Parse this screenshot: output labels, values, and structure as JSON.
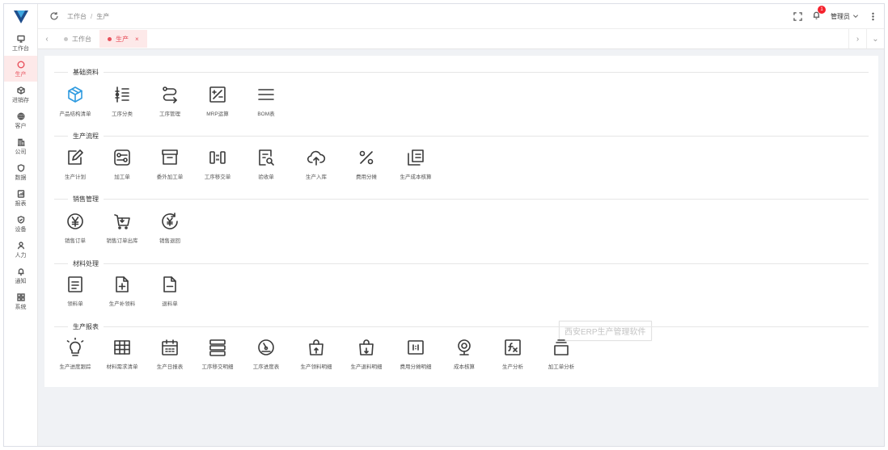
{
  "sidebar": {
    "items": [
      {
        "label": "工作台",
        "icon": "monitor-icon"
      },
      {
        "label": "生产",
        "icon": "circle-icon",
        "active": true
      },
      {
        "label": "进销存",
        "icon": "box-icon"
      },
      {
        "label": "客户",
        "icon": "globe-icon"
      },
      {
        "label": "公司",
        "icon": "building-icon"
      },
      {
        "label": "数据",
        "icon": "shield-icon"
      },
      {
        "label": "报表",
        "icon": "report-icon"
      },
      {
        "label": "设备",
        "icon": "device-icon"
      },
      {
        "label": "人力",
        "icon": "user-icon"
      },
      {
        "label": "通知",
        "icon": "bell-icon"
      },
      {
        "label": "系统",
        "icon": "grid-icon"
      }
    ]
  },
  "header": {
    "breadcrumb": [
      "工作台",
      "生产"
    ],
    "notification_count": "1",
    "user_name": "管理员"
  },
  "tabs": [
    {
      "label": "工作台",
      "active": false
    },
    {
      "label": "生产",
      "active": true,
      "close": "×"
    }
  ],
  "sections": [
    {
      "title": "基础资料",
      "items": [
        "产品结构清单",
        "工序分类",
        "工序管理",
        "MRP运算",
        "BOM表"
      ]
    },
    {
      "title": "生产流程",
      "items": [
        "生产计划",
        "加工单",
        "委外加工单",
        "工序移交单",
        "验收单",
        "生产入库",
        "费用分摊",
        "生产成本核算"
      ]
    },
    {
      "title": "销售管理",
      "items": [
        "销售订单",
        "销售订单出库",
        "销售退回"
      ]
    },
    {
      "title": "材料处理",
      "items": [
        "领料单",
        "生产补领料",
        "退料单"
      ]
    },
    {
      "title": "生产报表",
      "items": [
        "生产进度跟踪",
        "材料需求清单",
        "生产日报表",
        "工序移交明细",
        "工序进度表",
        "生产领料明细",
        "生产退料明细",
        "费用分摊明细",
        "成本核算",
        "生产分析",
        "加工单分析"
      ]
    }
  ],
  "watermark": "西安ERP生产管理软件",
  "colors": {
    "accent": "#e8505b",
    "accent_bg": "#fde9e9",
    "logo": "#1f4e8c"
  }
}
